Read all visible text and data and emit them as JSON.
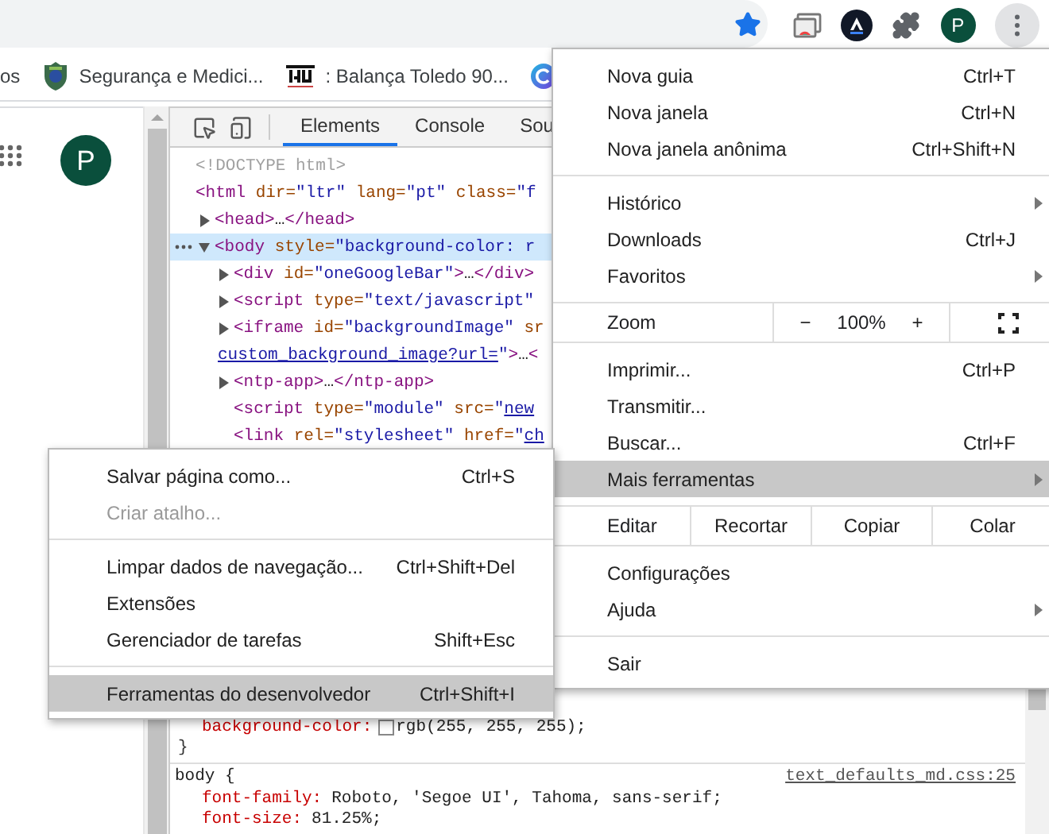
{
  "toolbar": {
    "avatar_letter": "P",
    "menu_open": true
  },
  "bookmarks": [
    {
      "kind": "text",
      "label": "os"
    },
    {
      "kind": "shield",
      "label": "Segurança e Medici..."
    },
    {
      "kind": "logo",
      "label": ": Balança Toledo 90..."
    },
    {
      "kind": "circle"
    }
  ],
  "page": {
    "avatar_letter": "P"
  },
  "devtools": {
    "tabs": [
      {
        "label": "Elements",
        "selected": true
      },
      {
        "label": "Console",
        "selected": false
      },
      {
        "label": "Sou",
        "selected": false
      }
    ],
    "dom": [
      {
        "lines": [
          [
            {
              "kind": "comment",
              "text": "<!DOCTYPE html>"
            }
          ]
        ]
      },
      {
        "lines": [
          [
            {
              "kind": "tag",
              "text": "<html"
            },
            {
              "kind": "attr",
              "text": " dir="
            },
            {
              "kind": "val",
              "text": "\"ltr\""
            },
            {
              "kind": "attr",
              "text": " lang="
            },
            {
              "kind": "val",
              "text": "\"pt\""
            },
            {
              "kind": "attr",
              "text": " class="
            },
            {
              "kind": "val",
              "text": "\"f"
            }
          ]
        ],
        "children": [
          {
            "expanded": false,
            "selected": false,
            "lines": [
              [
                {
                  "kind": "tag",
                  "text": "<head>"
                },
                {
                  "kind": "text",
                  "text": "…"
                },
                {
                  "kind": "tag",
                  "text": "</head>"
                }
              ]
            ]
          },
          {
            "expanded": true,
            "selected": true,
            "lines": [
              [
                {
                  "kind": "tag",
                  "text": "<body"
                },
                {
                  "kind": "attr",
                  "text": " style="
                },
                {
                  "kind": "val",
                  "text": "\"background-color: r"
                }
              ]
            ],
            "children": [
              {
                "expanded": false,
                "selected": false,
                "lines": [
                  [
                    {
                      "kind": "tag",
                      "text": "<div"
                    },
                    {
                      "kind": "attr",
                      "text": " id="
                    },
                    {
                      "kind": "val",
                      "text": "\"oneGoogleBar\""
                    },
                    {
                      "kind": "tag",
                      "text": ">"
                    },
                    {
                      "kind": "text",
                      "text": "…"
                    },
                    {
                      "kind": "tag",
                      "text": "</div>"
                    }
                  ]
                ]
              },
              {
                "expanded": false,
                "selected": false,
                "lines": [
                  [
                    {
                      "kind": "tag",
                      "text": "<script"
                    },
                    {
                      "kind": "attr",
                      "text": " type="
                    },
                    {
                      "kind": "val",
                      "text": "\"text/javascript\""
                    }
                  ]
                ]
              },
              {
                "expanded": false,
                "selected": false,
                "lines": [
                  [
                    {
                      "kind": "tag",
                      "text": "<iframe"
                    },
                    {
                      "kind": "attr",
                      "text": " id="
                    },
                    {
                      "kind": "val",
                      "text": "\"backgroundImage\""
                    },
                    {
                      "kind": "attr",
                      "text": " sr"
                    }
                  ],
                  [
                    {
                      "kind": "link",
                      "text": "custom_background_image?url="
                    },
                    {
                      "kind": "val",
                      "text": "\""
                    },
                    {
                      "kind": "tag",
                      "text": ">"
                    },
                    {
                      "kind": "text",
                      "text": "…"
                    },
                    {
                      "kind": "tag",
                      "text": "<"
                    }
                  ]
                ]
              },
              {
                "expanded": false,
                "selected": false,
                "lines": [
                  [
                    {
                      "kind": "tag",
                      "text": "<ntp-app>"
                    },
                    {
                      "kind": "text",
                      "text": "…"
                    },
                    {
                      "kind": "tag",
                      "text": "</ntp-app>"
                    }
                  ]
                ]
              },
              {
                "selected": false,
                "lines": [
                  [
                    {
                      "kind": "tag",
                      "text": "<script"
                    },
                    {
                      "kind": "attr",
                      "text": " type="
                    },
                    {
                      "kind": "val",
                      "text": "\"module\""
                    },
                    {
                      "kind": "attr",
                      "text": " src="
                    },
                    {
                      "kind": "val",
                      "text": "\""
                    },
                    {
                      "kind": "link",
                      "text": "new"
                    }
                  ]
                ]
              },
              {
                "selected": false,
                "lines": [
                  [
                    {
                      "kind": "tag",
                      "text": "<link"
                    },
                    {
                      "kind": "attr",
                      "text": " rel="
                    },
                    {
                      "kind": "val",
                      "text": "\"stylesheet\""
                    },
                    {
                      "kind": "attr",
                      "text": " href="
                    },
                    {
                      "kind": "val",
                      "text": "\""
                    },
                    {
                      "kind": "link",
                      "text": "ch"
                    }
                  ]
                ]
              }
            ]
          }
        ]
      }
    ],
    "styles": [
      {
        "kind": "decl",
        "property": "background-color:",
        "color": "#ffffff",
        "value": "rgb(255, 255, 255);"
      },
      {
        "kind": "close",
        "text": "}"
      },
      {
        "kind": "rule",
        "selector": "body {",
        "source": "text_defaults_md.css:25"
      },
      {
        "kind": "decl",
        "property": "font-family:",
        "value": "Roboto, 'Segoe UI', Tahoma, sans-serif;"
      },
      {
        "kind": "decl",
        "property": "font-size:",
        "value": "81.25%;"
      }
    ]
  },
  "menu": {
    "sections": [
      [
        {
          "kind": "item",
          "label": "Nova guia",
          "shortcut": "Ctrl+T",
          "submenu": false,
          "highlighted": false,
          "disabled": false
        },
        {
          "kind": "item",
          "label": "Nova janela",
          "shortcut": "Ctrl+N",
          "submenu": false,
          "highlighted": false,
          "disabled": false
        },
        {
          "kind": "item",
          "label": "Nova janela anônima",
          "shortcut": "Ctrl+Shift+N",
          "submenu": false,
          "highlighted": false,
          "disabled": false
        }
      ],
      [
        {
          "kind": "item",
          "label": "Histórico",
          "submenu": true,
          "highlighted": false,
          "disabled": false
        },
        {
          "kind": "item",
          "label": "Downloads",
          "shortcut": "Ctrl+J",
          "submenu": false,
          "highlighted": false,
          "disabled": false
        },
        {
          "kind": "item",
          "label": "Favoritos",
          "submenu": true,
          "highlighted": false,
          "disabled": false
        }
      ],
      [
        {
          "kind": "zoom",
          "label": "Zoom",
          "minus": "−",
          "value": "100%",
          "plus": "+"
        }
      ],
      [
        {
          "kind": "item",
          "label": "Imprimir...",
          "shortcut": "Ctrl+P",
          "submenu": false,
          "highlighted": false,
          "disabled": false
        },
        {
          "kind": "item",
          "label": "Transmitir...",
          "submenu": false,
          "highlighted": false,
          "disabled": false
        },
        {
          "kind": "item",
          "label": "Buscar...",
          "shortcut": "Ctrl+F",
          "submenu": false,
          "highlighted": false,
          "disabled": false
        },
        {
          "kind": "item",
          "label": "Mais ferramentas",
          "submenu": true,
          "highlighted": true,
          "disabled": false
        }
      ],
      [
        {
          "kind": "edit",
          "label": "Editar",
          "actions": [
            "Recortar",
            "Copiar",
            "Colar"
          ]
        }
      ],
      [
        {
          "kind": "item",
          "label": "Configurações",
          "submenu": false,
          "highlighted": false,
          "disabled": false
        },
        {
          "kind": "item",
          "label": "Ajuda",
          "submenu": true,
          "highlighted": false,
          "disabled": false
        }
      ],
      [
        {
          "kind": "item",
          "label": "Sair",
          "submenu": false,
          "highlighted": false,
          "disabled": false
        }
      ]
    ]
  },
  "submenu": {
    "sections": [
      [
        {
          "kind": "item",
          "label": "Salvar página como...",
          "shortcut": "Ctrl+S",
          "submenu": false,
          "highlighted": false,
          "disabled": false
        },
        {
          "kind": "item",
          "label": "Criar atalho...",
          "submenu": false,
          "highlighted": false,
          "disabled": true
        }
      ],
      [
        {
          "kind": "item",
          "label": "Limpar dados de navegação...",
          "shortcut": "Ctrl+Shift+Del",
          "submenu": false,
          "highlighted": false,
          "disabled": false
        },
        {
          "kind": "item",
          "label": "Extensões",
          "submenu": false,
          "highlighted": false,
          "disabled": false
        },
        {
          "kind": "item",
          "label": "Gerenciador de tarefas",
          "shortcut": "Shift+Esc",
          "submenu": false,
          "highlighted": false,
          "disabled": false
        }
      ],
      [
        {
          "kind": "item",
          "label": "Ferramentas do desenvolvedor",
          "shortcut": "Ctrl+Shift+I",
          "submenu": false,
          "highlighted": true,
          "disabled": false
        }
      ]
    ]
  }
}
